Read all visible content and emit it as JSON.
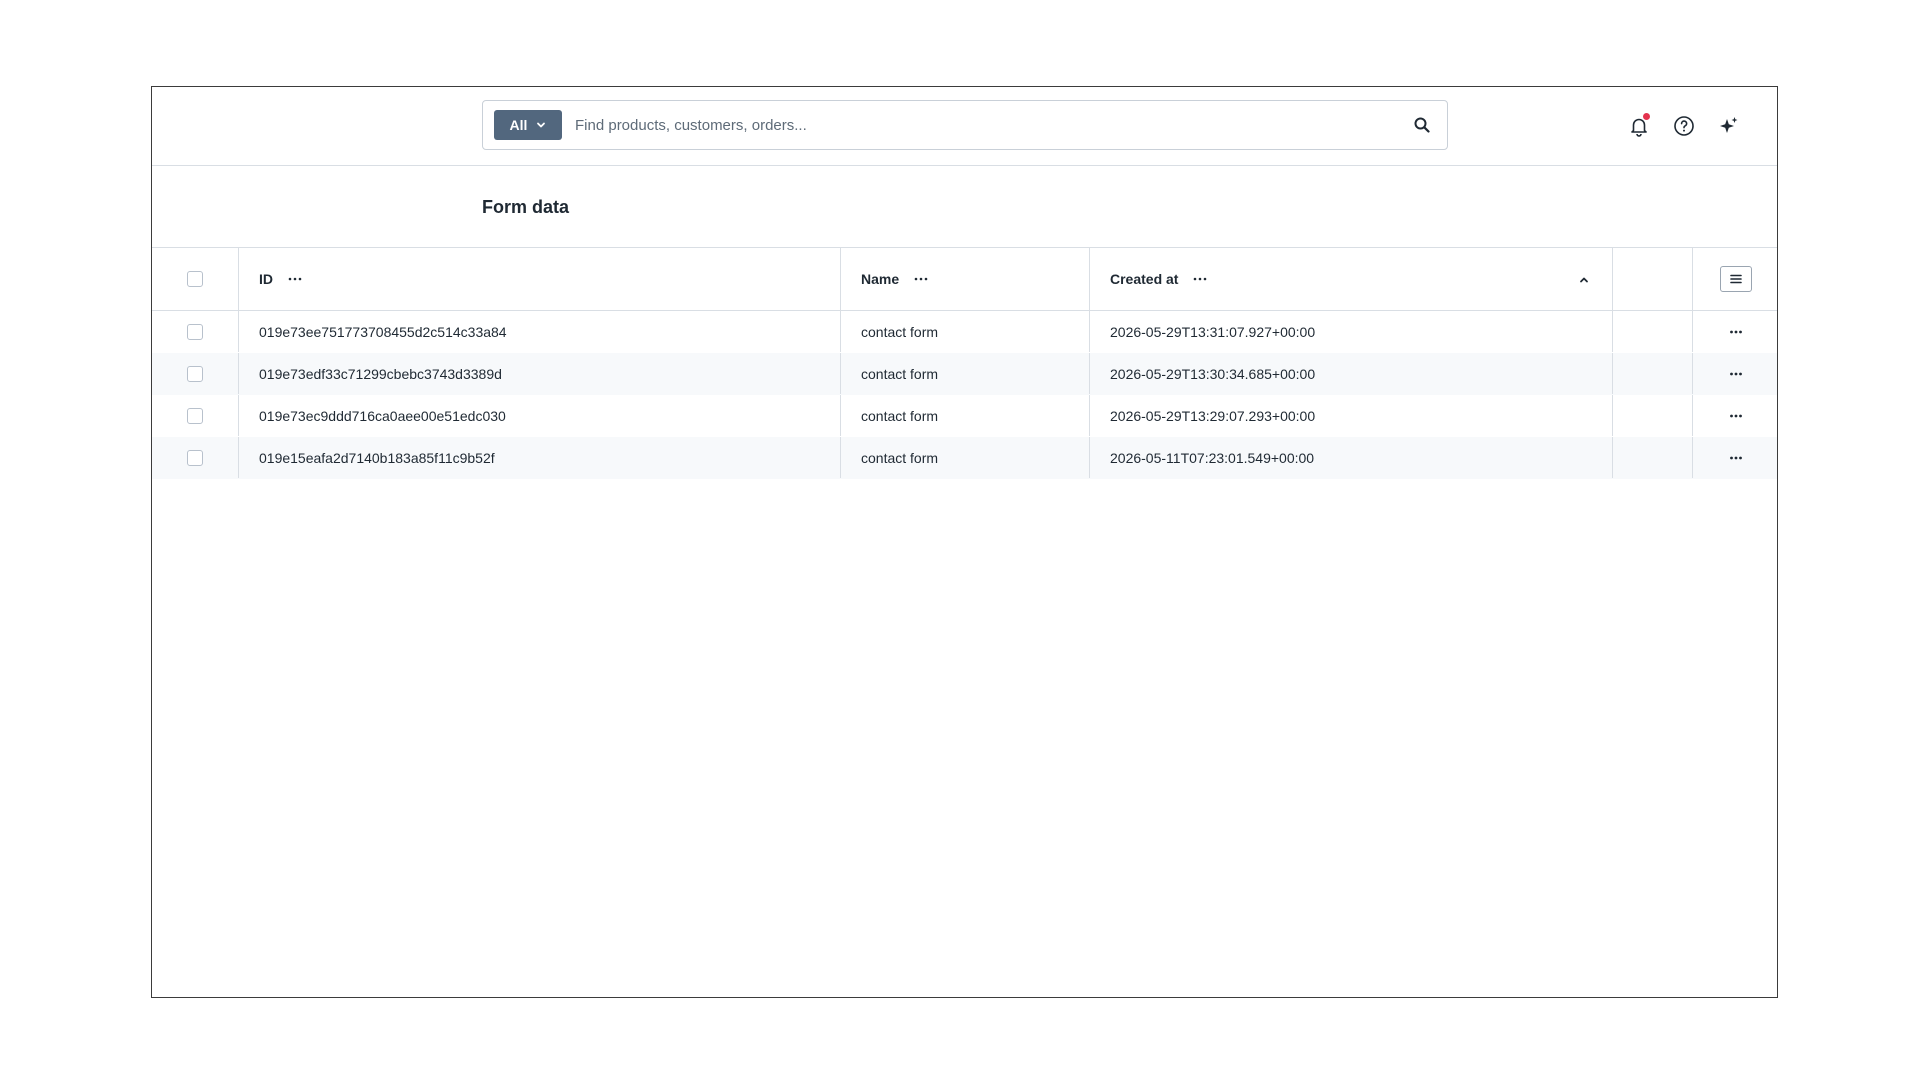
{
  "header": {
    "scope_label": "All",
    "search_placeholder": "Find products, customers, orders..."
  },
  "page": {
    "title": "Form data"
  },
  "table": {
    "columns": {
      "id": "ID",
      "name": "Name",
      "created_at": "Created at"
    },
    "sort": "ascending",
    "rows": [
      {
        "id": "019e73ee751773708455d2c514c33a84",
        "name": "contact form",
        "created_at": "2026-05-29T13:31:07.927+00:00"
      },
      {
        "id": "019e73edf33c71299cbebc3743d3389d",
        "name": "contact form",
        "created_at": "2026-05-29T13:30:34.685+00:00"
      },
      {
        "id": "019e73ec9ddd716ca0aee00e51edc030",
        "name": "contact form",
        "created_at": "2026-05-29T13:29:07.293+00:00"
      },
      {
        "id": "019e15eafa2d7140b183a85f11c9b52f",
        "name": "contact form",
        "created_at": "2026-05-11T07:23:01.549+00:00"
      }
    ]
  },
  "icons": {
    "notification": "bell-icon",
    "help": "help-circle-icon",
    "ai": "sparkles-icon",
    "search": "search-icon"
  },
  "colors": {
    "scope_button": "#52677e",
    "notification_dot": "#e4334e",
    "alt_row": "#f7f9fb"
  }
}
